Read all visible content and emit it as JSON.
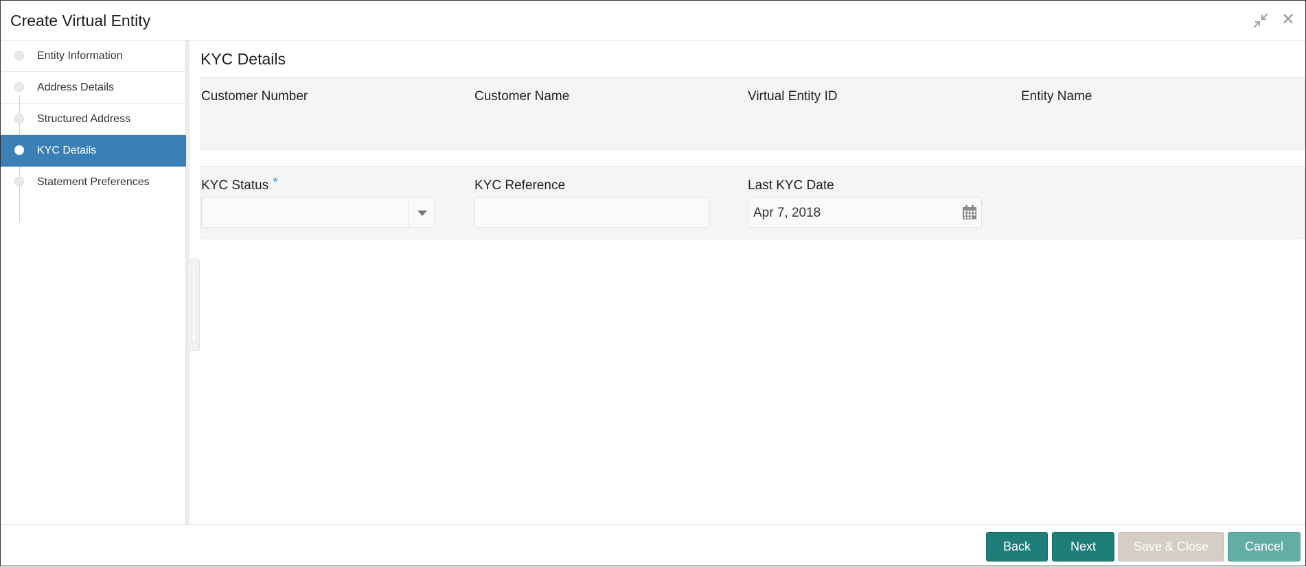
{
  "window": {
    "title": "Create Virtual Entity",
    "minimize_icon": "collapse-arrows-icon",
    "close_icon": "close-icon",
    "close_glyph": "✕"
  },
  "sidebar": {
    "items": [
      {
        "label": "Entity Information",
        "active": false
      },
      {
        "label": "Address Details",
        "active": false
      },
      {
        "label": "Structured Address",
        "active": false
      },
      {
        "label": "KYC Details",
        "active": true
      },
      {
        "label": "Statement Preferences",
        "active": false
      }
    ],
    "active_color": "#3a7fb6"
  },
  "main": {
    "section_title": "KYC Details",
    "info": {
      "customer_number_label": "Customer Number",
      "customer_name_label": "Customer Name",
      "virtual_entity_id_label": "Virtual Entity ID",
      "entity_name_label": "Entity Name"
    },
    "form": {
      "kyc_status_label": "KYC Status",
      "required_marker": "*",
      "kyc_status_value": "",
      "kyc_reference_label": "KYC Reference",
      "kyc_reference_value": "",
      "last_kyc_date_label": "Last KYC Date",
      "last_kyc_date_value": "Apr 7, 2018",
      "calendar_icon": "calendar-icon"
    }
  },
  "footer": {
    "back_label": "Back",
    "next_label": "Next",
    "save_close_label": "Save & Close",
    "cancel_label": "Cancel",
    "primary_color": "#1f7d79",
    "disabled_color": "#d4cec5",
    "cancel_color": "#63ada7"
  }
}
